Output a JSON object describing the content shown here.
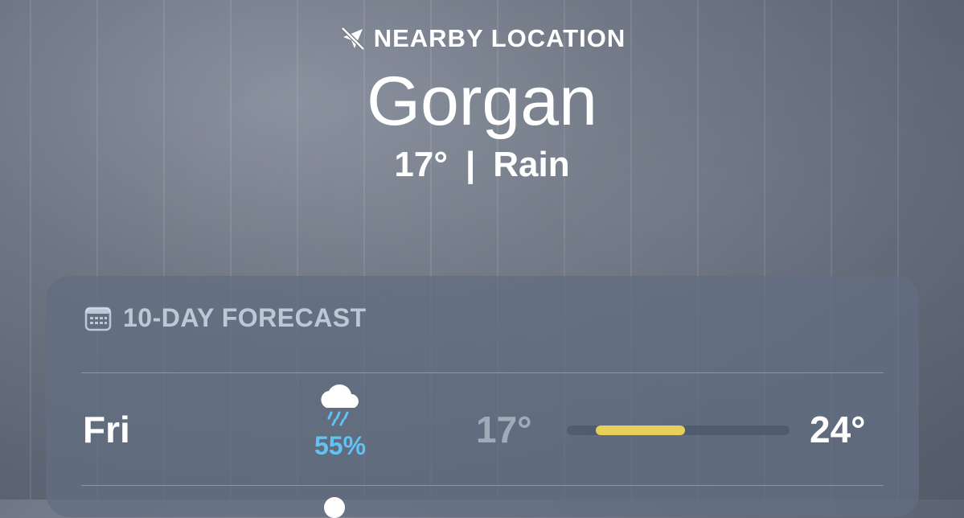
{
  "header": {
    "location_label": "NEARBY LOCATION",
    "city": "Gorgan",
    "temperature": "17°",
    "separator": "|",
    "condition": "Rain"
  },
  "forecast": {
    "title": "10-DAY FORECAST",
    "days": [
      {
        "day": "Fri",
        "icon": "cloud-rain-icon",
        "precip": "55%",
        "low": "17°",
        "high": "24°",
        "range_bar": {
          "start_fraction": 0.13,
          "end_fraction": 0.53,
          "color": "#e5d05a"
        }
      }
    ]
  },
  "colors": {
    "precip": "#5fc4f5",
    "card_bg": "#626e80"
  }
}
